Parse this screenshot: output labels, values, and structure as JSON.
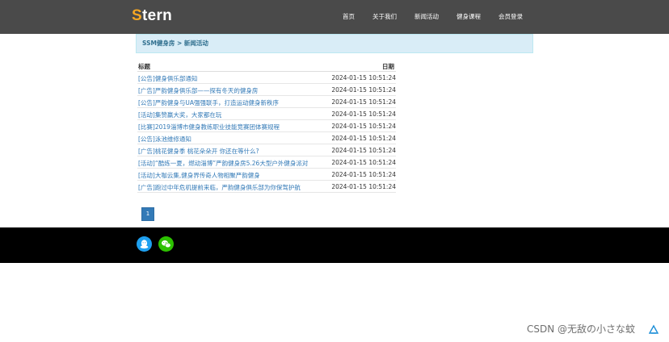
{
  "header": {
    "logo_first": "S",
    "logo_rest": "tern",
    "nav": [
      {
        "label": "首页"
      },
      {
        "label": "关于我们"
      },
      {
        "label": "新闻活动"
      },
      {
        "label": "健身课程"
      },
      {
        "label": "会员登录"
      }
    ]
  },
  "breadcrumb": {
    "text": "SSM健身房 > 新闻活动"
  },
  "table": {
    "headers": {
      "title": "标题",
      "date": "日期"
    },
    "rows": [
      {
        "title": "[公告]健身俱乐部通知",
        "date": "2024-01-15 10:51:24"
      },
      {
        "title": "[广告]严韵健身俱乐部——探有冬天的健身房",
        "date": "2024-01-15 10:51:24"
      },
      {
        "title": "[公告]严韵健身与UA强强联手，打造运动健身新秩序",
        "date": "2024-01-15 10:51:24"
      },
      {
        "title": "[活动]集赞赢大奖，大家都在玩",
        "date": "2024-01-15 10:51:24"
      },
      {
        "title": "[比赛]2019淄博市健身教练职业技能竞赛团体赛规程",
        "date": "2024-01-15 10:51:24"
      },
      {
        "title": "[公告]泳池维修通知",
        "date": "2024-01-15 10:51:24"
      },
      {
        "title": "[广告]桃花健身季 桃花朵朵开 你还在等什么?",
        "date": "2024-01-15 10:51:24"
      },
      {
        "title": "[活动]“酷炼一夏，燃动淄博”严韵健身房5.26大型户外健身派对",
        "date": "2024-01-15 10:51:24"
      },
      {
        "title": "[活动]大咖云集,健身界传奇人物相聚严韵健身",
        "date": "2024-01-15 10:51:24"
      },
      {
        "title": "[广告]跑过中年危机提前来临，严韵健身俱乐部为你保驾护航",
        "date": "2024-01-15 10:51:24"
      }
    ]
  },
  "pagination": {
    "current": "1"
  },
  "footer": {
    "icons": [
      "qq-icon",
      "wechat-icon"
    ]
  },
  "watermark": {
    "text": "CSDN @无敌の小さな蚊"
  },
  "colors": {
    "navbar": "#4a4a4a",
    "logo_accent": "#f5a623",
    "link": "#337ab7",
    "breadcrumb_bg": "#d9edf7",
    "footer": "#000000",
    "qq": "#1ea0f0",
    "wechat": "#2dc100"
  }
}
